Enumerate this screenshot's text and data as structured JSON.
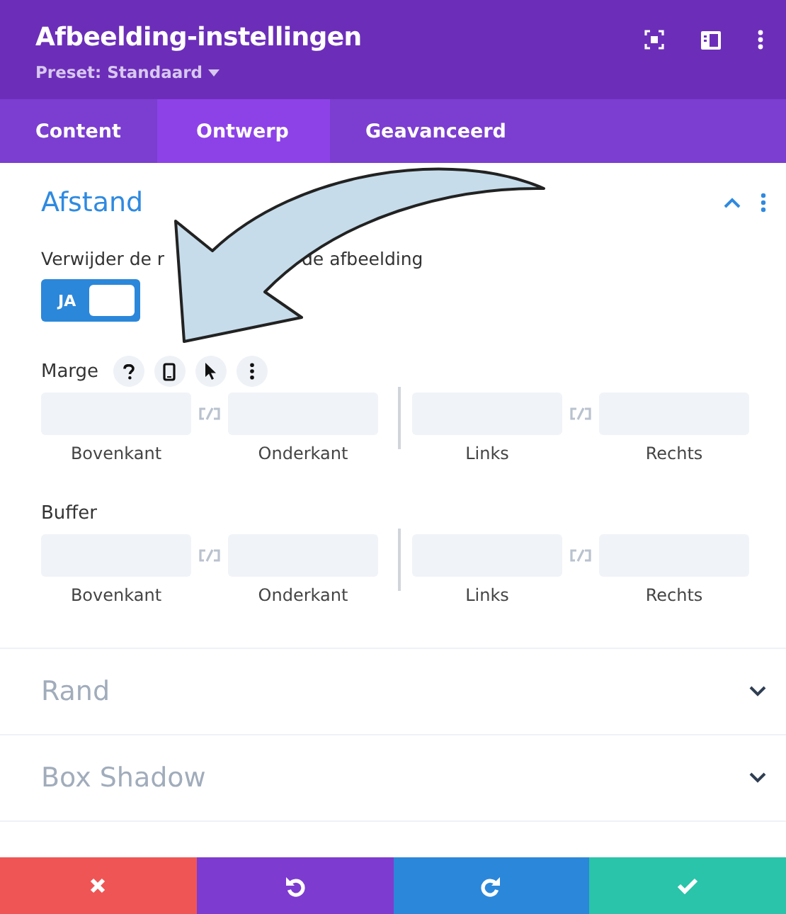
{
  "header": {
    "title": "Afbeelding-instellingen",
    "preset": "Preset: Standaard"
  },
  "tabs": [
    {
      "label": "Content",
      "selected": false
    },
    {
      "label": "Ontwerp",
      "selected": true
    },
    {
      "label": "Geavanceerd",
      "selected": false
    }
  ],
  "sections": [
    {
      "title": "Afstand",
      "expanded": true,
      "toggle_label_parts": [
        "Verwijder de r",
        "de afbeelding"
      ],
      "toggle": {
        "text": "JA",
        "on": true
      },
      "groups": [
        {
          "label": "Marge",
          "has_tools": true,
          "fields": [
            "Bovenkant",
            "Onderkant",
            "Links",
            "Rechts"
          ]
        },
        {
          "label": "Buffer",
          "has_tools": false,
          "fields": [
            "Bovenkant",
            "Onderkant",
            "Links",
            "Rechts"
          ]
        }
      ]
    },
    {
      "title": "Rand",
      "expanded": false
    },
    {
      "title": "Box Shadow",
      "expanded": false
    }
  ],
  "actions": [
    {
      "kind": "cancel"
    },
    {
      "kind": "undo"
    },
    {
      "kind": "redo"
    },
    {
      "kind": "save"
    }
  ]
}
